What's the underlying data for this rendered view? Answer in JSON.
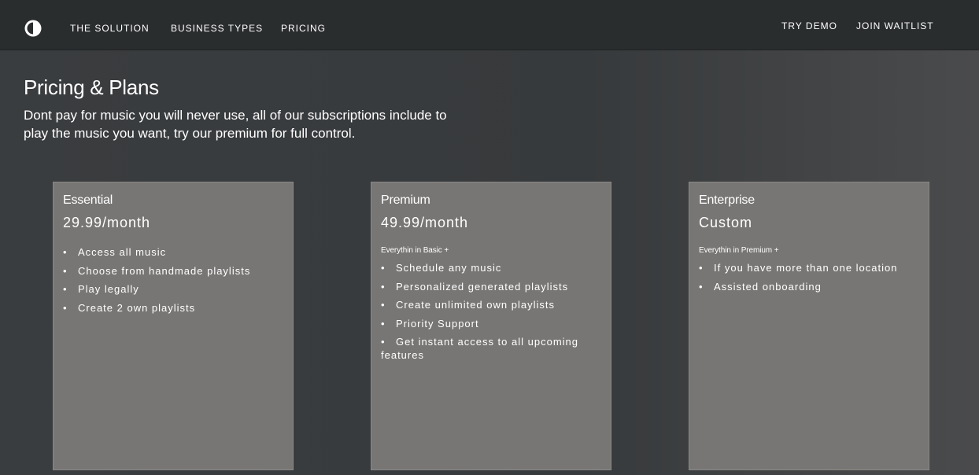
{
  "nav": {
    "logo": "brand-logo-icon",
    "links": [
      "THE SOLUTION",
      "BUSINESS TYPES",
      "PRICING"
    ],
    "actions": [
      "TRY DEMO",
      "JOIN WAITLIST"
    ]
  },
  "hero": {
    "title": "Pricing & Plans",
    "subtitle": "Dont pay for music you will never use, all of our subscriptions include to play the music you want, try our premium for full control."
  },
  "plans": [
    {
      "name": "Essential",
      "price": "29.99/month",
      "note": "",
      "features": [
        "Access all music",
        "Choose from handmade playlists",
        "Play legally",
        "Create 2 own playlists"
      ]
    },
    {
      "name": "Premium",
      "price": "49.99/month",
      "note": "Everythin in Basic +",
      "features": [
        "Schedule any music",
        "Personalized generated playlists",
        "Create unlimited own playlists",
        "Priority Support",
        "Get instant access to all upcoming features"
      ]
    },
    {
      "name": "Enterprise",
      "price": "Custom",
      "note": "Everythin in Premium +",
      "features": [
        "If you have more than one location",
        "Assisted onboarding"
      ]
    }
  ],
  "colors": {
    "topbar": "#2a2d2e",
    "background": "#363a3c",
    "card": "#787674",
    "text": "#ffffff"
  }
}
